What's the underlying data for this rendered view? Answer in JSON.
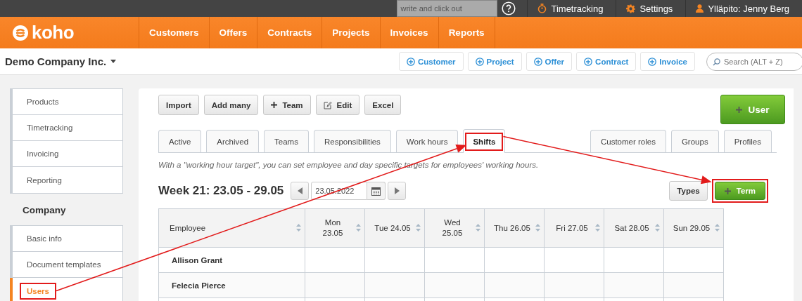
{
  "top_bar": {
    "note_placeholder": "write and click out",
    "links": [
      {
        "kind": "timer",
        "label": "Timetracking"
      },
      {
        "kind": "gear",
        "label": "Settings"
      },
      {
        "kind": "user",
        "label": "Ylläpito: Jenny Berg"
      }
    ]
  },
  "logo": {
    "text": "koho"
  },
  "nav": [
    {
      "label": "Customers",
      "selected": false
    },
    {
      "label": "Offers",
      "selected": false
    },
    {
      "label": "Contracts",
      "selected": false
    },
    {
      "label": "Projects",
      "selected": false
    },
    {
      "label": "Invoices",
      "selected": false
    },
    {
      "label": "Reports",
      "selected": false
    }
  ],
  "company": {
    "name": "Demo Company Inc."
  },
  "quick_add": [
    "Customer",
    "Project",
    "Offer",
    "Contract",
    "Invoice"
  ],
  "search": {
    "placeholder": "Search (ALT + Z)"
  },
  "sidebar": {
    "groups": [
      {
        "items": [
          {
            "label": "Products",
            "selected": false,
            "highlighted": false
          },
          {
            "label": "Timetracking",
            "selected": false,
            "highlighted": false
          },
          {
            "label": "Invoicing",
            "selected": false,
            "highlighted": false
          },
          {
            "label": "Reporting",
            "selected": false,
            "highlighted": false
          }
        ]
      },
      {
        "title": "Company",
        "items": [
          {
            "label": "Basic info",
            "selected": false,
            "highlighted": false
          },
          {
            "label": "Document templates",
            "selected": false,
            "highlighted": false
          },
          {
            "label": "Users",
            "selected": true,
            "highlighted": true
          }
        ]
      }
    ]
  },
  "toolbar": [
    {
      "label": "Import",
      "kind": "plain"
    },
    {
      "label": "Add many",
      "kind": "plain"
    },
    {
      "label": "Team",
      "kind": "plus"
    },
    {
      "label": "Edit",
      "kind": "edit"
    },
    {
      "label": "Excel",
      "kind": "plain"
    }
  ],
  "add_user_button": "User",
  "tabs": [
    {
      "label": "Active",
      "selected": false,
      "highlighted": false
    },
    {
      "label": "Archived",
      "selected": false,
      "highlighted": false
    },
    {
      "label": "Teams",
      "selected": false,
      "highlighted": false
    },
    {
      "label": "Responsibilities",
      "selected": false,
      "highlighted": false
    },
    {
      "label": "Work hours",
      "selected": false,
      "highlighted": false
    },
    {
      "label": "Shifts",
      "selected": true,
      "highlighted": true
    }
  ],
  "right_tabs": [
    {
      "label": "Customer roles",
      "selected": false
    },
    {
      "label": "Groups",
      "selected": false
    },
    {
      "label": "Profiles",
      "selected": false
    }
  ],
  "hint": "With a \"working hour target\", you can set employee and day specific targets for employees' working hours.",
  "week": {
    "title": "Week 21: 23.05 - 29.05",
    "date": "23.05.2022"
  },
  "types_button": "Types",
  "term_button": {
    "label": "Term",
    "highlighted": true
  },
  "arrows_between_highlights": true,
  "table": {
    "columns": [
      "Employee",
      "Mon\n23.05",
      "Tue 24.05",
      "Wed\n25.05",
      "Thu 26.05",
      "Fri 27.05",
      "Sat 28.05",
      "Sun 29.05"
    ],
    "rows": [
      {
        "name": "Allison Grant"
      },
      {
        "name": "Felecia Pierce"
      }
    ]
  }
}
